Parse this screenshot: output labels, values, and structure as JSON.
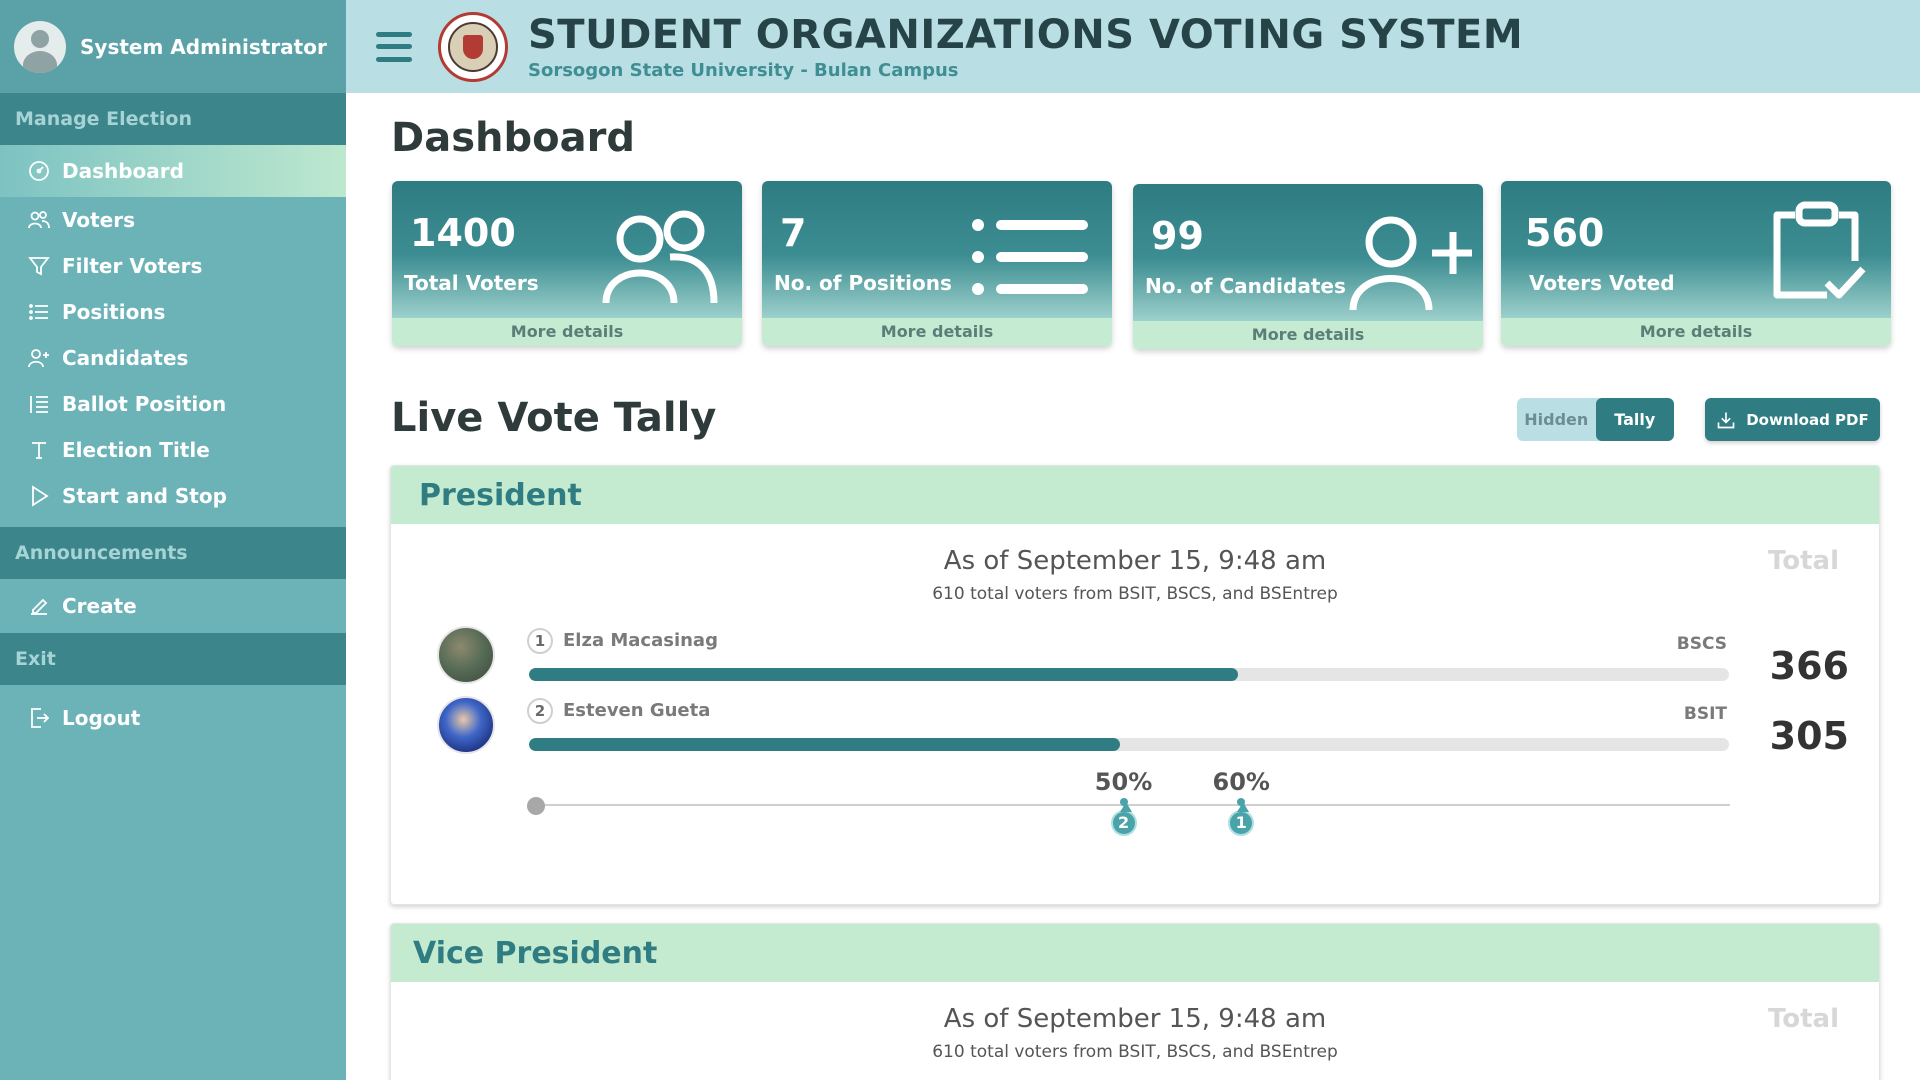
{
  "sidebar": {
    "user_name": "System Administrator",
    "sections": {
      "manage": "Manage Election",
      "announcements": "Announcements",
      "exit": "Exit"
    },
    "manage_items": [
      {
        "label": "Dashboard",
        "icon": "dashboard-icon"
      },
      {
        "label": "Voters",
        "icon": "users-icon"
      },
      {
        "label": "Filter Voters",
        "icon": "filter-icon"
      },
      {
        "label": "Positions",
        "icon": "list-icon"
      },
      {
        "label": "Candidates",
        "icon": "add-user-icon"
      },
      {
        "label": "Ballot Position",
        "icon": "ordered-list-icon"
      },
      {
        "label": "Election Title",
        "icon": "text-icon"
      },
      {
        "label": "Start and Stop",
        "icon": "play-icon"
      }
    ],
    "announcement_items": [
      {
        "label": "Create",
        "icon": "pencil-icon"
      }
    ],
    "exit_items": [
      {
        "label": "Logout",
        "icon": "logout-icon"
      }
    ]
  },
  "header": {
    "title": "STUDENT ORGANIZATIONS VOTING SYSTEM",
    "subtitle": "Sorsogon State University - Bulan Campus"
  },
  "dashboard": {
    "title": "Dashboard",
    "cards": [
      {
        "value": "1400",
        "label": "Total Voters",
        "more": "More details",
        "icon": "users-icon"
      },
      {
        "value": "7",
        "label": "No. of Positions",
        "more": "More details",
        "icon": "list-icon"
      },
      {
        "value": "99",
        "label": "No. of Candidates",
        "more": "More details",
        "icon": "add-user-icon"
      },
      {
        "value": "560",
        "label": "Voters Voted",
        "more": "More details",
        "icon": "clipboard-check-icon"
      }
    ]
  },
  "tally": {
    "title": "Live Vote Tally",
    "toggle": {
      "hidden": "Hidden",
      "tally": "Tally",
      "selected": "Tally"
    },
    "download_label": "Download PDF",
    "panels": [
      {
        "position": "President",
        "as_of": "As of September 15, 9:48 am",
        "voters_info": "610 total voters from BSIT, BSCS, and BSEntrep",
        "total_label": "Total",
        "candidates": [
          {
            "num": "1",
            "name": "Elza Macasinag",
            "program": "BSCS",
            "votes": "366",
            "percent": 60
          },
          {
            "num": "2",
            "name": "Esteven Gueta",
            "program": "BSIT",
            "votes": "305",
            "percent": 50
          }
        ],
        "markers": [
          {
            "pct": "50%",
            "value": 50,
            "num": "2"
          },
          {
            "pct": "60%",
            "value": 60,
            "num": "1"
          }
        ]
      },
      {
        "position": "Vice President",
        "as_of": "As of September 15, 9:48 am",
        "voters_info": "610 total voters from BSIT, BSCS, and BSEntrep",
        "total_label": "Total"
      }
    ]
  },
  "colors": {
    "sidebar": "#6cb3b8",
    "sidebar_section": "#3b858b",
    "accent": "#2f7d82",
    "header_bg": "#b9dfe4",
    "panel_header": "#c4ebd0"
  }
}
